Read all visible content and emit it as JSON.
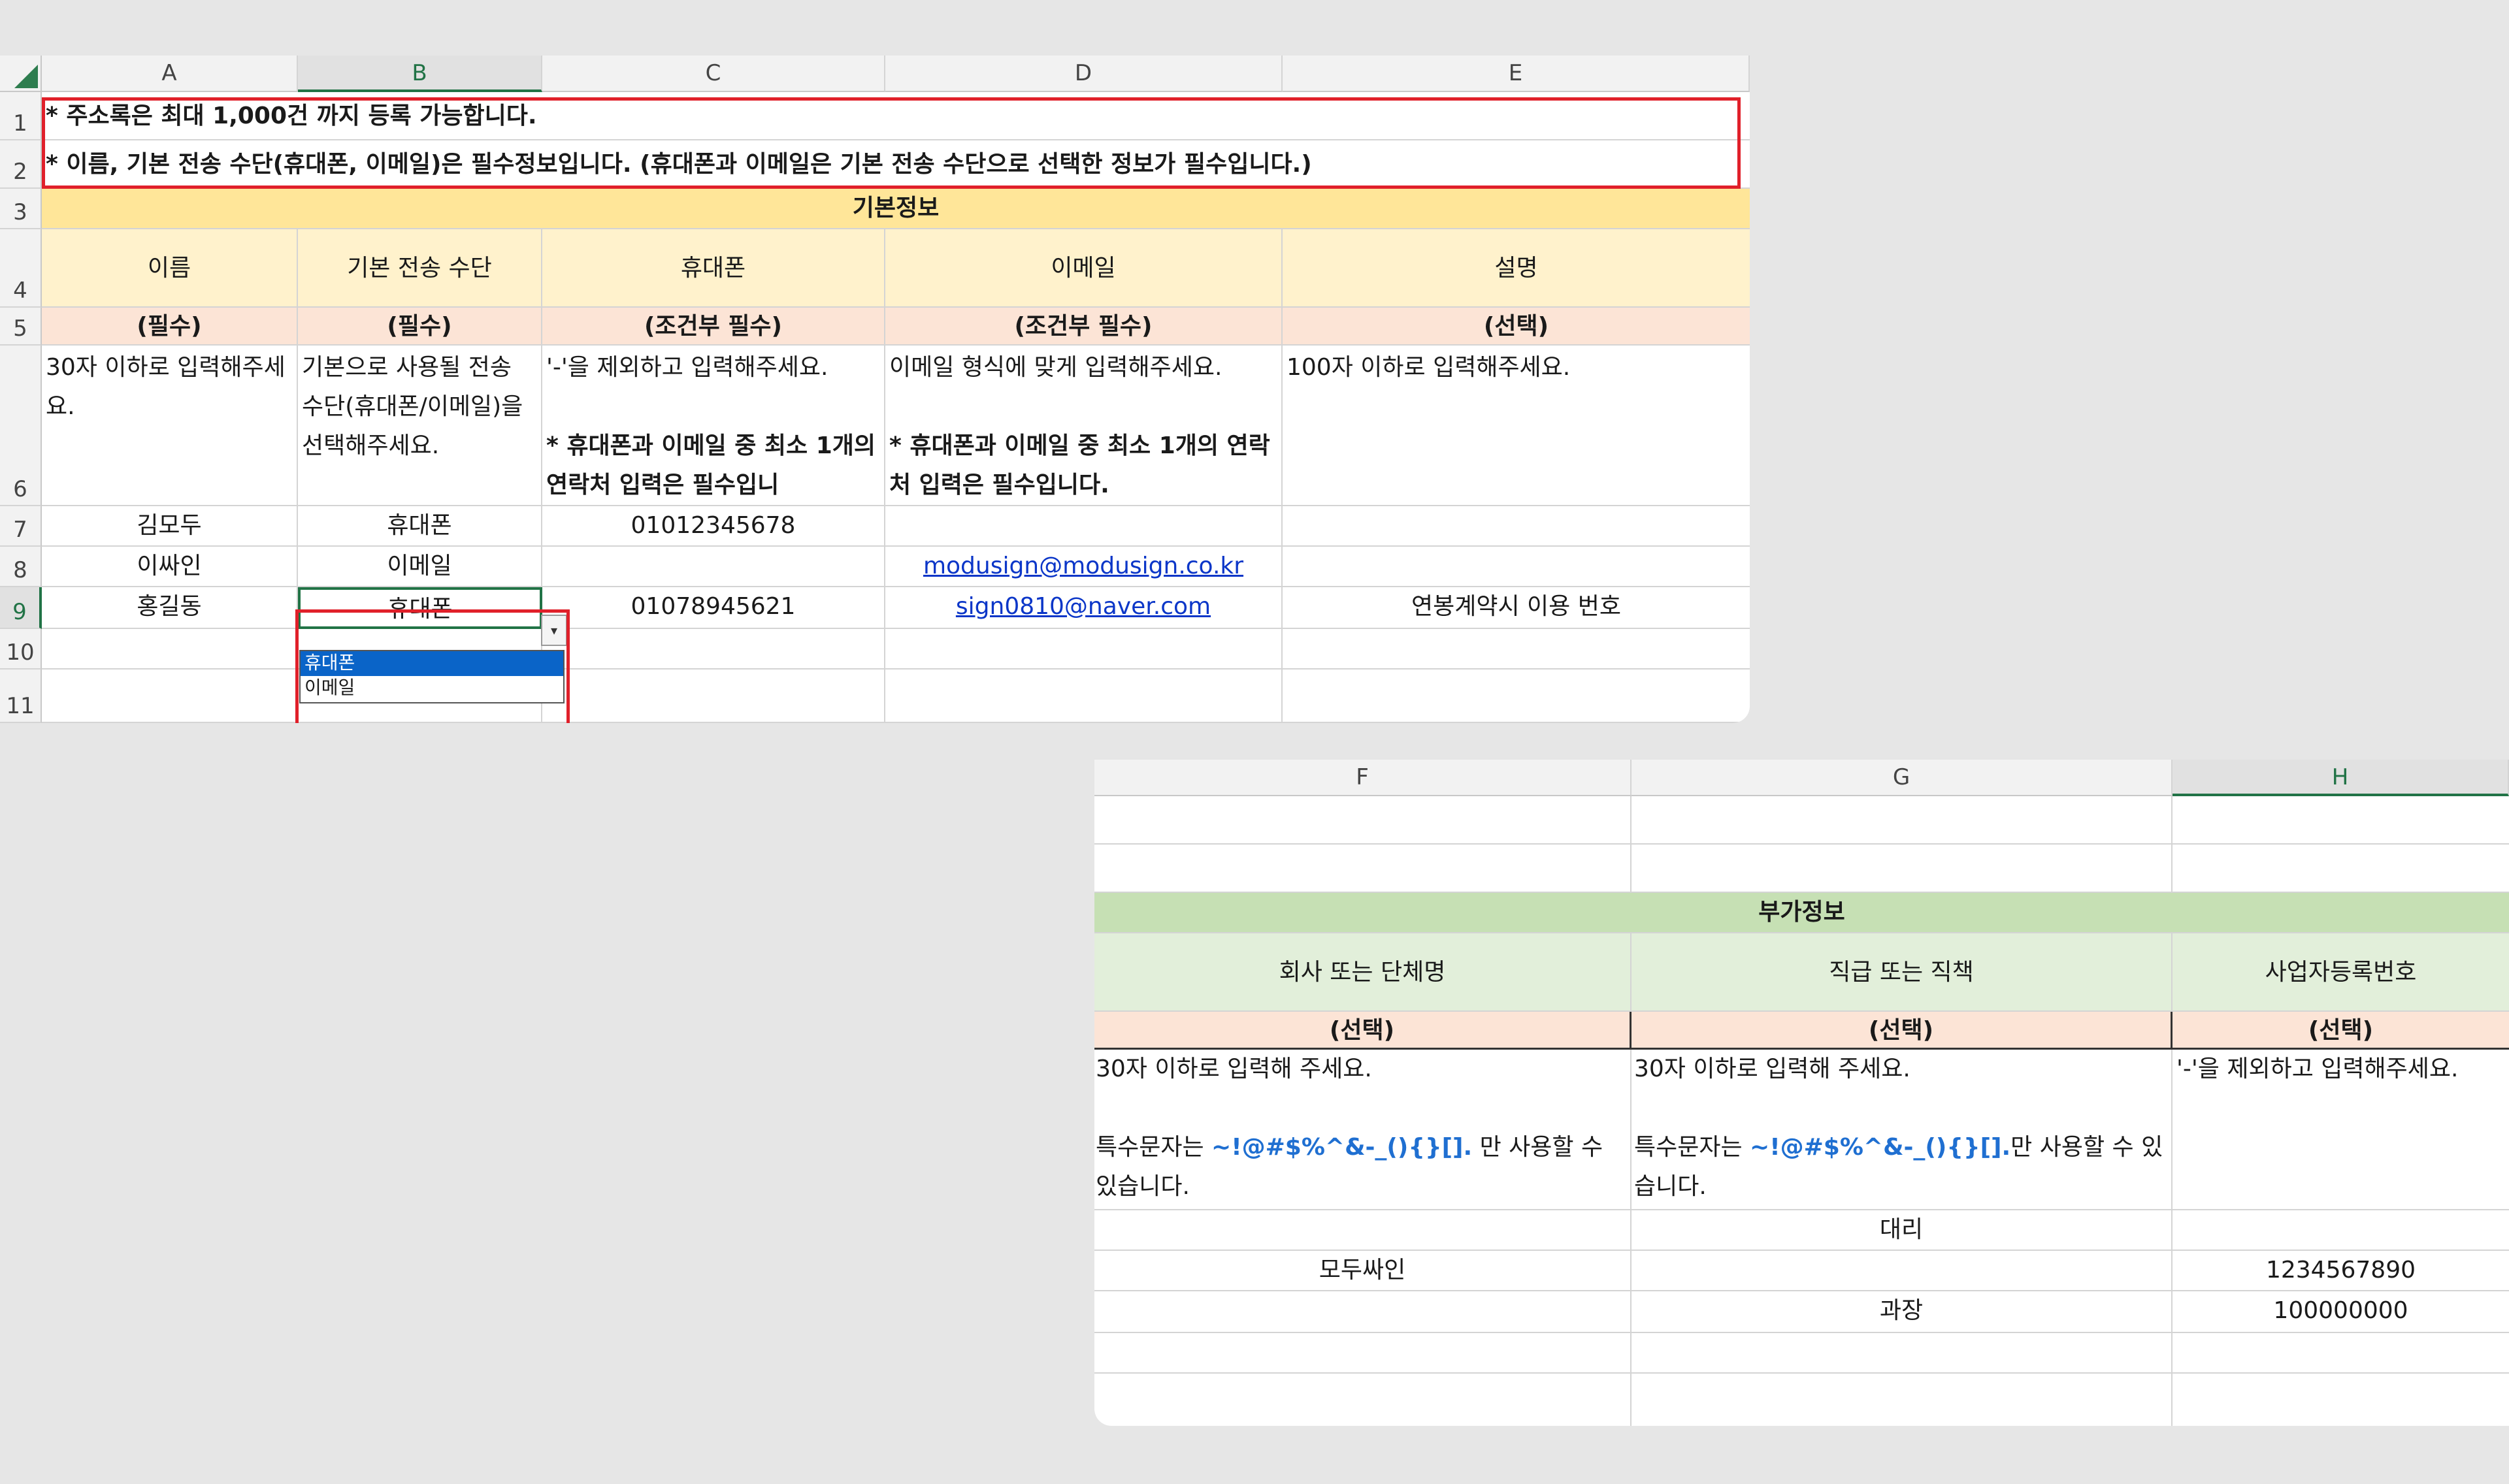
{
  "top_sheet": {
    "columns": [
      "A",
      "B",
      "C",
      "D",
      "E"
    ],
    "rows": [
      "1",
      "2",
      "3",
      "4",
      "5",
      "6",
      "7",
      "8",
      "9",
      "10",
      "11"
    ],
    "notice_1": "* 주소록은 최대 1,000건 까지 등록 가능합니다.",
    "notice_2": "* 이름, 기본 전송 수단(휴대폰, 이메일)은 필수정보입니다. (휴대폰과 이메일은 기본 전송 수단으로 선택한 정보가 필수입니다.)",
    "section_title": "기본정보",
    "headers": [
      "이름",
      "기본 전송 수단",
      "휴대폰",
      "이메일",
      "설명"
    ],
    "requirements": [
      "(필수)",
      "(필수)",
      "(조건부 필수)",
      "(조건부 필수)",
      "(선택)"
    ],
    "desc_a": "30자 이하로 입력해주세요.",
    "desc_b": "기본으로 사용될 전송 수단(휴대폰/이메일)을 선택해주세요.",
    "desc_c_1": "'-'을 제외하고 입력해주세요.",
    "desc_c_2": "* 휴대폰과 이메일 중 최소 1개의 연락처 입력은 필수입니",
    "desc_d_1": "이메일 형식에 맞게 입력해주세요.",
    "desc_d_2": "* 휴대폰과 이메일 중 최소 1개의 연락처 입력은 필수입니다.",
    "desc_e": "100자 이하로 입력해주세요.",
    "data_rows": [
      {
        "name": "김모두",
        "method": "휴대폰",
        "phone": "01012345678",
        "email": "",
        "note": ""
      },
      {
        "name": "이싸인",
        "method": "이메일",
        "phone": "",
        "email": "modusign@modusign.co.kr",
        "note": ""
      },
      {
        "name": "홍길동",
        "method": "휴대폰",
        "phone": "01078945621",
        "email": "sign0810@naver.com",
        "note": "연봉계약시 이용 번호"
      }
    ],
    "dropdown_options": [
      "휴대폰",
      "이메일"
    ],
    "dropdown_arrow": "▾"
  },
  "bottom_sheet": {
    "columns": [
      "F",
      "G",
      "H"
    ],
    "section_title": "부가정보",
    "headers": [
      "회사 또는 단체명",
      "직급 또는 직책",
      "사업자등록번호"
    ],
    "requirements": [
      "(선택)",
      "(선택)",
      "(선택)"
    ],
    "desc_f_1": "30자 이하로 입력해 주세요.",
    "desc_f_2_pre": "특수문자는 ",
    "desc_f_2_chars": "~!@#$%^&-_(){}[].",
    "desc_f_2_post": " 만 사용할 수",
    "desc_f_3": "있습니다.",
    "desc_g_1": "30자 이하로 입력해 주세요.",
    "desc_g_2_pre": "특수문자는 ",
    "desc_g_2_chars": "~!@#$%^&-_(){}[].",
    "desc_g_2_post": "만 사용할 수 있",
    "desc_g_3": "습니다.",
    "desc_h": "'-'을 제외하고 입력해주세요.",
    "data_rows": [
      {
        "company": "",
        "position": "대리",
        "biz_no": ""
      },
      {
        "company": "모두싸인",
        "position": "",
        "biz_no": "1234567890"
      },
      {
        "company": "",
        "position": "과장",
        "biz_no": "100000000"
      }
    ]
  },
  "colors": {
    "highlight_red": "#e0202a",
    "header_yellow": "#ffe699",
    "header_green": "#c6e0b4",
    "requirement_peach": "#fce4d6",
    "link_blue": "#0b36c8",
    "selection_green": "#217346"
  }
}
